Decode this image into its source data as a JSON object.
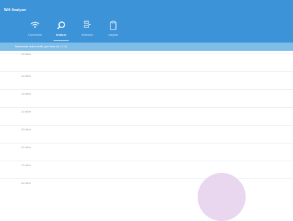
{
  "window": {
    "title": "Wifi Analyzer"
  },
  "tabs": [
    {
      "label": "Connection",
      "icon": "wifi-icon",
      "active": false
    },
    {
      "label": "Analyze",
      "icon": "search-icon",
      "active": true
    },
    {
      "label": "Networks",
      "icon": "networks-icon",
      "active": false
    },
    {
      "label": "Insights",
      "icon": "clipboard-icon",
      "active": false
    }
  ],
  "subbar": {
    "text": "Nenhumas redes estão (por item da 1.2.3)"
  },
  "y_axis": {
    "labels": [
      "-10 dBm",
      "-20 dBm",
      "-30 dBm",
      "-40 dBm",
      "-50 dBm",
      "-60 dBm",
      "-70 dBm",
      "-80 dBm"
    ]
  },
  "colors": {
    "app_bar": "#3d93d8",
    "subbar": "#7fbde9",
    "accent_bubble": "#e9d6ef"
  }
}
